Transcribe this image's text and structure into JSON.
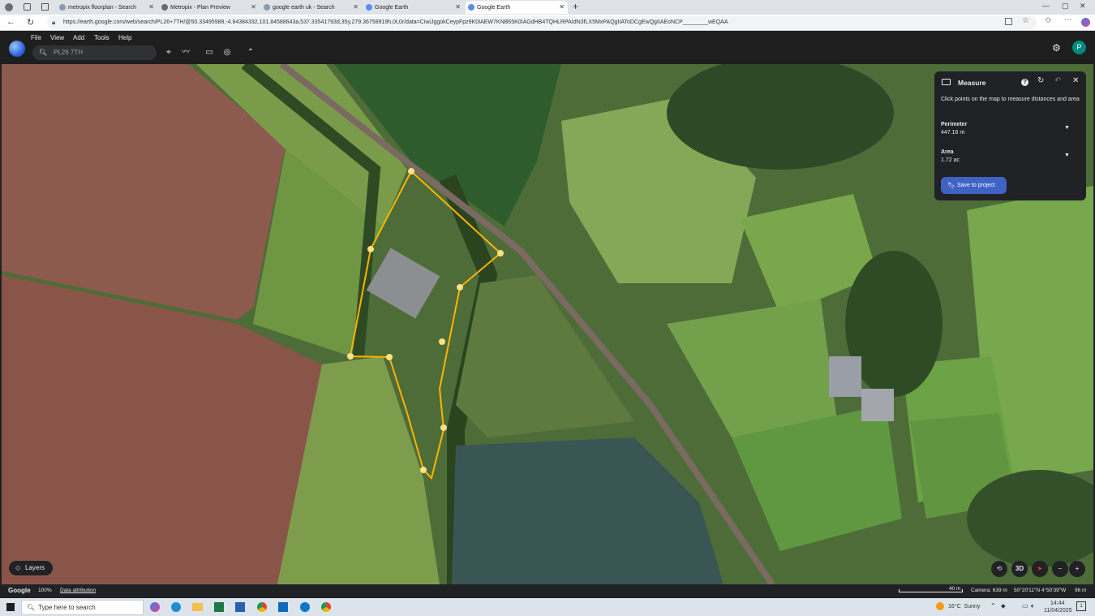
{
  "browser": {
    "tabs": [
      {
        "label": "metropix floorplan - Search"
      },
      {
        "label": "Metropix - Plan Preview"
      },
      {
        "label": "google earth uk - Search"
      },
      {
        "label": "Google Earth"
      },
      {
        "label": "Google Earth"
      }
    ],
    "url": "https://earth.google.com/web/search/PL26+7TH/@50.33495989,-4.84384332,101.84588643a,537.33541793d,35y,279.36758919h,0t,0r/data=CiwiJggokCeypFpz9K0IAEW7KNB65K0IAGdHB4TQHLRPAIdN3fLX5MxPAQgIIAToDCgEwQgIIAEoNCP________wEQAA"
  },
  "menu": {
    "items": [
      "File",
      "View",
      "Add",
      "Tools",
      "Help"
    ],
    "search_placeholder": "PL26 7TH",
    "avatar_letter": "P"
  },
  "measure": {
    "title": "Measure",
    "description": "Click points on the map to measure distances and area",
    "perimeter_label": "Perimeter",
    "perimeter_value": "447.16 m",
    "area_label": "Area",
    "area_value": "1.72 ac",
    "save_label": "Save to project"
  },
  "map_controls": {
    "layers_label": "Layers",
    "view_3d_label": "3D"
  },
  "status": {
    "brand": "Google",
    "zoom": "100%",
    "attribution": "Data attribution",
    "scale": "40 m",
    "camera": "Camera: 639 m",
    "coords": "50°20'11\"N 4°50'39\"W",
    "elevation": "96 m"
  },
  "taskbar": {
    "search_placeholder": "Type here to search",
    "weather": "16°C  Sunny",
    "time": "14:44",
    "date": "11/04/2025",
    "notifications": "1"
  }
}
